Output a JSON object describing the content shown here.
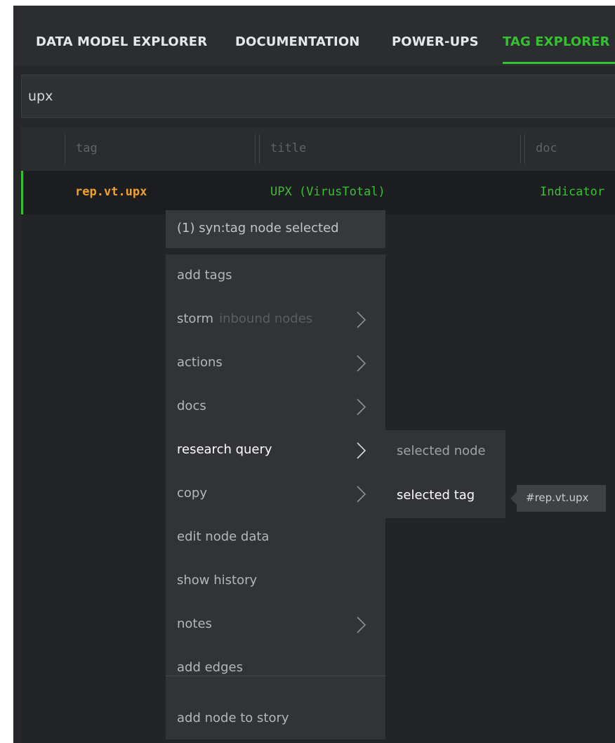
{
  "tabs": [
    {
      "label": "DATA MODEL EXPLORER"
    },
    {
      "label": "DOCUMENTATION"
    },
    {
      "label": "POWER-UPS"
    },
    {
      "label": "TAG EXPLORER",
      "active": true
    }
  ],
  "search": {
    "value": "upx"
  },
  "table": {
    "columns": [
      "tag",
      "title",
      "doc"
    ],
    "rows": [
      {
        "tag": "rep.vt.upx",
        "title": "UPX (VirusTotal)",
        "doc": "Indicator"
      }
    ]
  },
  "context_menu": {
    "header": "(1) syn:tag node selected",
    "items": [
      {
        "label": "add tags",
        "submenu": false
      },
      {
        "label": "storm",
        "hint": "inbound nodes",
        "submenu": true
      },
      {
        "label": "actions",
        "submenu": true
      },
      {
        "label": "docs",
        "submenu": true
      },
      {
        "label": "research query",
        "submenu": true,
        "highlighted": true
      },
      {
        "label": "copy",
        "submenu": true
      },
      {
        "label": "edit node data",
        "submenu": false
      },
      {
        "label": "show history",
        "submenu": false
      },
      {
        "label": "notes",
        "submenu": true
      },
      {
        "label": "add edges",
        "submenu": false
      },
      {
        "label": "add node to story",
        "submenu": false
      }
    ]
  },
  "submenu": {
    "items": [
      {
        "label": "selected node"
      },
      {
        "label": "selected tag",
        "highlighted": true
      }
    ]
  },
  "tooltip": {
    "text": "#rep.vt.upx"
  },
  "colors": {
    "accent_green": "#35c130",
    "tag_orange": "#f2a127",
    "background": "#25272a",
    "menu_bg": "#313336"
  },
  "icons": {
    "submenu_arrow": "chevron-right-icon"
  }
}
